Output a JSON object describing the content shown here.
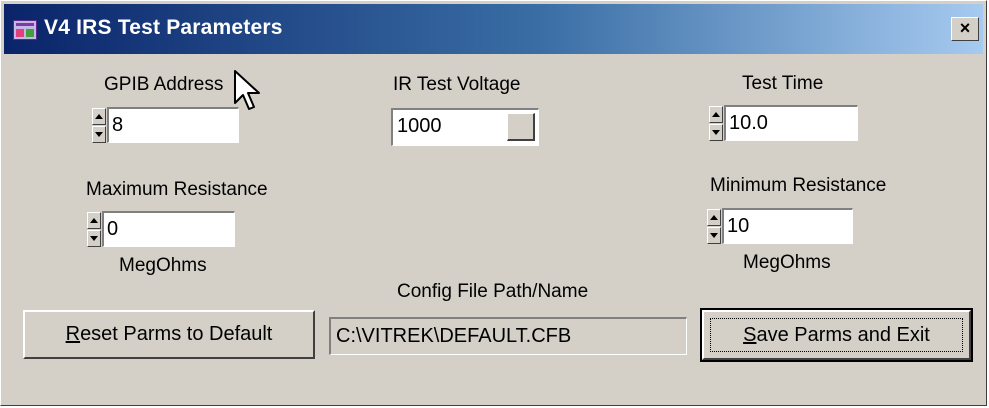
{
  "window": {
    "title": "V4 IRS Test Parameters",
    "close_label": "×"
  },
  "gpib": {
    "label": "GPIB Address",
    "value": "8"
  },
  "ir_voltage": {
    "label": "IR Test Voltage",
    "value": "1000"
  },
  "test_time": {
    "label": "Test Time",
    "value": "10.0"
  },
  "max_resistance": {
    "label": "Maximum Resistance",
    "value": "0",
    "unit": "MegOhms"
  },
  "min_resistance": {
    "label": "Minimum Resistance",
    "value": "10",
    "unit": "MegOhms"
  },
  "config": {
    "label": "Config File Path/Name",
    "value": "C:\\VITREK\\DEFAULT.CFB"
  },
  "buttons": {
    "reset_first": "R",
    "reset_rest": "eset Parms to Default",
    "save_first": "S",
    "save_rest": "ave Parms and Exit"
  },
  "icons": {
    "app": "app-icon",
    "close": "close-icon",
    "spin_up": "spin-up-icon",
    "spin_down": "spin-down-icon",
    "cursor": "mouse-pointer-icon"
  },
  "colors": {
    "title_start": "#0a246a",
    "title_end": "#a6caf0",
    "face": "#d4d0c8"
  }
}
